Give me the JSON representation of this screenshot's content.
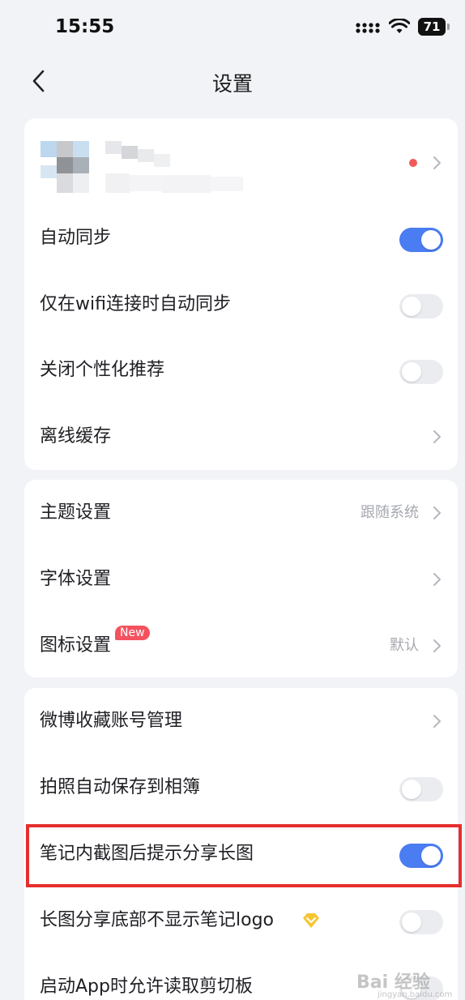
{
  "status_bar": {
    "time": "15:55",
    "battery": "71"
  },
  "nav": {
    "title": "设置"
  },
  "profile": {
    "name": "",
    "has_notification_dot": true
  },
  "section1": [
    {
      "label": "自动同步",
      "control": "toggle",
      "on": true
    },
    {
      "label": "仅在wifi连接时自动同步",
      "control": "toggle",
      "on": false
    },
    {
      "label": "关闭个性化推荐",
      "control": "toggle",
      "on": false
    },
    {
      "label": "离线缓存",
      "control": "chevron"
    }
  ],
  "section2": [
    {
      "label": "主题设置",
      "value": "跟随系统",
      "control": "chevron"
    },
    {
      "label": "字体设置",
      "value": "",
      "control": "chevron"
    },
    {
      "label": "图标设置",
      "badge": "New",
      "value": "默认",
      "control": "chevron"
    }
  ],
  "section3": [
    {
      "label": "微博收藏账号管理",
      "control": "chevron"
    },
    {
      "label": "拍照自动保存到相簿",
      "control": "toggle",
      "on": false
    },
    {
      "label": "笔记内截图后提示分享长图",
      "control": "toggle",
      "on": true,
      "highlighted": true
    },
    {
      "label": "长图分享底部不显示笔记logo",
      "control": "toggle",
      "on": false,
      "vip": true
    },
    {
      "label": "启动App时允许读取剪切板",
      "control": "toggle",
      "on": false
    }
  ],
  "watermark": {
    "text": "Bai 经验",
    "sub": "jingyan.baidu.com"
  },
  "colors": {
    "accent": "#4a7cf2",
    "highlight": "#e62e2e",
    "badge": "#f5515f"
  },
  "icons": [
    "back-arrow-icon",
    "chevron-right-icon",
    "signal-icon",
    "wifi-icon",
    "battery-icon",
    "vip-diamond-icon"
  ]
}
